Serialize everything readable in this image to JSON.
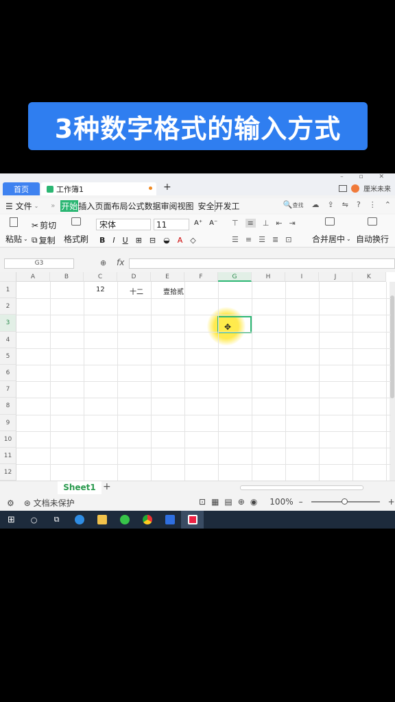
{
  "banner": {
    "title": "3种数字格式的输入方式"
  },
  "tabs": {
    "home": "首页",
    "doc": "工作簿1",
    "plus": "+"
  },
  "user": {
    "name": "厘米未来"
  },
  "menu": {
    "file": "☰ 文件",
    "items": [
      "开始",
      "插入",
      "页面布局",
      "公式",
      "数据",
      "审阅",
      "视图",
      "安全",
      "开发工"
    ],
    "active": "开始",
    "search": "查找"
  },
  "ribbon": {
    "paste": "粘贴",
    "cut": "剪切",
    "copy": "复制",
    "format_painter": "格式刷",
    "font": "宋体",
    "size": "11",
    "merge": "合并居中",
    "wrap": "自动换行",
    "bold": "B",
    "italic": "I",
    "underline": "U"
  },
  "formula": {
    "name_box": "G3",
    "fx": "fx"
  },
  "grid": {
    "columns": [
      "A",
      "B",
      "C",
      "D",
      "E",
      "F",
      "G",
      "H",
      "I",
      "J",
      "K"
    ],
    "rows": [
      "1",
      "2",
      "3",
      "4",
      "5",
      "6",
      "7",
      "8",
      "9",
      "10",
      "11",
      "12"
    ],
    "selected_col": "G",
    "selected_row": "3",
    "cells": {
      "C1": "12",
      "D1": "十二",
      "E1": "壹拾贰"
    }
  },
  "sheets": {
    "active": "Sheet1",
    "add": "+"
  },
  "status": {
    "protection": "文档未保护",
    "zoom": "100%",
    "zoom_level": 0.5
  },
  "colors": {
    "accent": "#2bb673",
    "banner": "#2f7ef0",
    "home_tab": "#3e82f0",
    "taskbar": "#1d2b3c"
  }
}
